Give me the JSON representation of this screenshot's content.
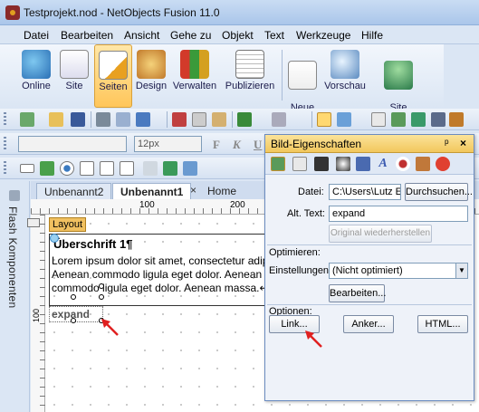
{
  "window": {
    "title": "Testprojekt.nod - NetObjects Fusion 11.0"
  },
  "menu": [
    "Datei",
    "Bearbeiten",
    "Ansicht",
    "Gehe zu",
    "Objekt",
    "Text",
    "Werkzeuge",
    "Hilfe"
  ],
  "ribbon": {
    "buttons": [
      {
        "label": "Online"
      },
      {
        "label": "Site"
      },
      {
        "label": "Seiten"
      },
      {
        "label": "Design"
      },
      {
        "label": "Verwalten"
      },
      {
        "label": "Publizieren"
      },
      {
        "label": "Neue\nSeite"
      },
      {
        "label": "Vorschau"
      },
      {
        "label": "Site\npublizieren"
      }
    ]
  },
  "format_bar": {
    "font_size": "12px",
    "bold": "F",
    "italic": "K",
    "underline": "U"
  },
  "sidebar": {
    "label": "Flash Komponenten"
  },
  "tabs": [
    {
      "label": "Unbenannt2"
    },
    {
      "label": "Unbenannt1"
    },
    {
      "label": "Home"
    }
  ],
  "ruler": {
    "mark100": "100",
    "mark200": "200",
    "vmark100": "100"
  },
  "page": {
    "layout_tag": "Layout",
    "heading": "Überschrift 1¶",
    "lorem": "Lorem ipsum dolor sit amet, consectetur adipiscing elit. Aenean commodo ligula eget dolor. Aenean massa. Aenean commodo ligula eget dolor. Aenean massa.↵",
    "image_text": "expand"
  },
  "panel": {
    "title": "Bild-Eigenschaften",
    "pin": "ᵖ",
    "close": "×",
    "datei_label": "Datei:",
    "datei_value": "C:\\Users\\Lutz Eicl",
    "durchsuchen": "Durchsuchen...",
    "alt_label": "Alt. Text:",
    "alt_value": "expand",
    "restore": "Original wiederherstellen",
    "optimieren_label": "Optimieren:",
    "einstellungen_label": "Einstellungen:",
    "einstellungen_value": "(Nicht optimiert)",
    "bearbeiten": "Bearbeiten...",
    "optionen_label": "Optionen:",
    "link": "Link...",
    "anker": "Anker...",
    "html": "HTML..."
  }
}
